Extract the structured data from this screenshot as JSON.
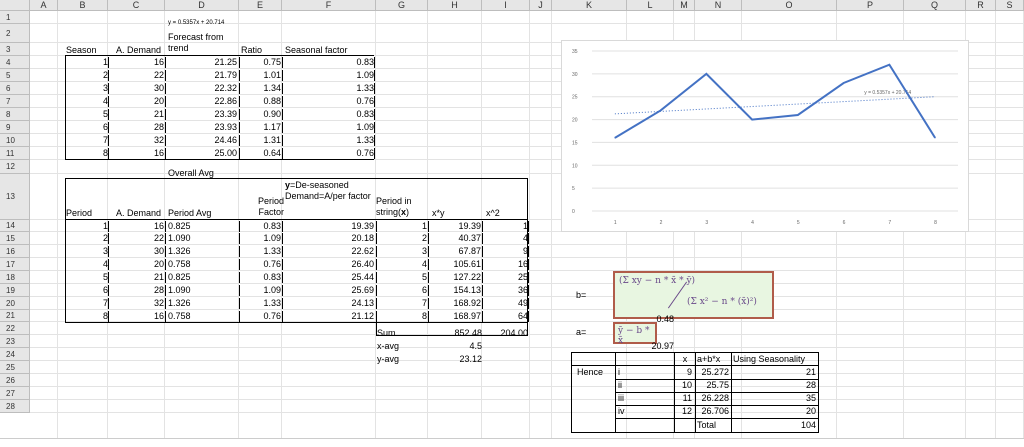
{
  "columns": [
    "A",
    "B",
    "C",
    "D",
    "E",
    "F",
    "G",
    "H",
    "I",
    "J",
    "K",
    "L",
    "M",
    "N",
    "O",
    "P",
    "Q",
    "R",
    "S"
  ],
  "rows": [
    "1",
    "2",
    "3",
    "4",
    "5",
    "6",
    "7",
    "8",
    "9",
    "10",
    "11",
    "12",
    "13",
    "14",
    "15",
    "16",
    "17",
    "18",
    "19",
    "20",
    "21",
    "22",
    "23",
    "24",
    "25",
    "26",
    "27",
    "28"
  ],
  "d1_equation": "y = 0.5357x + 20.714",
  "table1": {
    "headers": {
      "season": "Season",
      "a_demand": "A. Demand",
      "forecast": "Forecast from trend",
      "ratio": "Ratio",
      "seasonal": "Seasonal factor"
    },
    "rows": [
      {
        "season": "1",
        "demand": "16",
        "trend": "21.25",
        "ratio": "0.75",
        "sf": "0.83"
      },
      {
        "season": "2",
        "demand": "22",
        "trend": "21.79",
        "ratio": "1.01",
        "sf": "1.09"
      },
      {
        "season": "3",
        "demand": "30",
        "trend": "22.32",
        "ratio": "1.34",
        "sf": "1.33"
      },
      {
        "season": "4",
        "demand": "20",
        "trend": "22.86",
        "ratio": "0.88",
        "sf": "0.76"
      },
      {
        "season": "5",
        "demand": "21",
        "trend": "23.39",
        "ratio": "0.90",
        "sf": "0.83"
      },
      {
        "season": "6",
        "demand": "28",
        "trend": "23.93",
        "ratio": "1.17",
        "sf": "1.09"
      },
      {
        "season": "7",
        "demand": "32",
        "trend": "24.46",
        "ratio": "1.31",
        "sf": "1.33"
      },
      {
        "season": "8",
        "demand": "16",
        "trend": "25.00",
        "ratio": "0.64",
        "sf": "0.76"
      }
    ],
    "overall_avg": "Overall Avg"
  },
  "table2": {
    "headers": {
      "period": "Period",
      "a_demand": "A. Demand",
      "period_avg": "Period Avg",
      "period_factor": "Period Factor",
      "deseason_y": "y",
      "deseason_rest": "=De-seasoned Demand=A/per factor",
      "period_in_string": "Period in string(",
      "period_in_x": "x",
      "period_in_close": ")",
      "xy": "x*y",
      "x2": "x^2"
    },
    "rows": [
      {
        "p": "1",
        "d": "16",
        "avg": "0.825",
        "pf": "0.83",
        "ds": "19.39",
        "x": "1",
        "xy": "19.39",
        "x2": "1"
      },
      {
        "p": "2",
        "d": "22",
        "avg": "1.090",
        "pf": "1.09",
        "ds": "20.18",
        "x": "2",
        "xy": "40.37",
        "x2": "4"
      },
      {
        "p": "3",
        "d": "30",
        "avg": "1.326",
        "pf": "1.33",
        "ds": "22.62",
        "x": "3",
        "xy": "67.87",
        "x2": "9"
      },
      {
        "p": "4",
        "d": "20",
        "avg": "0.758",
        "pf": "0.76",
        "ds": "26.40",
        "x": "4",
        "xy": "105.61",
        "x2": "16"
      },
      {
        "p": "5",
        "d": "21",
        "avg": "0.825",
        "pf": "0.83",
        "ds": "25.44",
        "x": "5",
        "xy": "127.22",
        "x2": "25"
      },
      {
        "p": "6",
        "d": "28",
        "avg": "1.090",
        "pf": "1.09",
        "ds": "25.69",
        "x": "6",
        "xy": "154.13",
        "x2": "36"
      },
      {
        "p": "7",
        "d": "32",
        "avg": "1.326",
        "pf": "1.33",
        "ds": "24.13",
        "x": "7",
        "xy": "168.92",
        "x2": "49"
      },
      {
        "p": "8",
        "d": "16",
        "avg": "0.758",
        "pf": "0.76",
        "ds": "21.12",
        "x": "8",
        "xy": "168.97",
        "x2": "64"
      }
    ],
    "sum_label": "Sum",
    "sum_xy": "852.48",
    "sum_x2": "204.00",
    "xavg_label": "x-avg",
    "xavg": "4.5",
    "yavg_label": "y-avg",
    "yavg": "23.12"
  },
  "formulas": {
    "b_label": "b=",
    "b_numerator": "(Σ xy − n * x̄ * ȳ)",
    "b_denominator": "(Σ x² − n * (x̄)²)",
    "b_value": "0.48",
    "a_label": "a=",
    "a_formula": "ȳ − b * x̄",
    "a_value": "20.97"
  },
  "forecast": {
    "hence": "Hence",
    "headers": {
      "x": "x",
      "axbx": "a+b*x",
      "seasonality": "Using Seasonality"
    },
    "rows": [
      {
        "label": "i",
        "x": "9",
        "axbx": "25.272",
        "s": "21"
      },
      {
        "label": "ii",
        "x": "10",
        "axbx": "25.75",
        "s": "28"
      },
      {
        "label": "iii",
        "x": "11",
        "axbx": "26.228",
        "s": "35"
      },
      {
        "label": "iv",
        "x": "12",
        "axbx": "26.706",
        "s": "20"
      }
    ],
    "total_label": "Total",
    "total": "104"
  },
  "chart_data": {
    "type": "line",
    "x": [
      1,
      2,
      3,
      4,
      5,
      6,
      7,
      8
    ],
    "series": [
      {
        "values": [
          16,
          22,
          30,
          20,
          21,
          28,
          32,
          16
        ],
        "color": "#4472c4"
      }
    ],
    "trendline": {
      "equation": "y = 0.5357x + 20.714",
      "slope": 0.5357,
      "intercept": 20.714,
      "color": "#4472c4",
      "style": "dotted"
    },
    "ylim": [
      0,
      35
    ],
    "yticks": [
      "0",
      "5",
      "10",
      "15",
      "20",
      "25",
      "30",
      "35"
    ],
    "xticks": [
      "1",
      "2",
      "3",
      "4",
      "5",
      "6",
      "7",
      "8"
    ],
    "grid": true,
    "title": "",
    "xlabel": "",
    "ylabel": ""
  }
}
